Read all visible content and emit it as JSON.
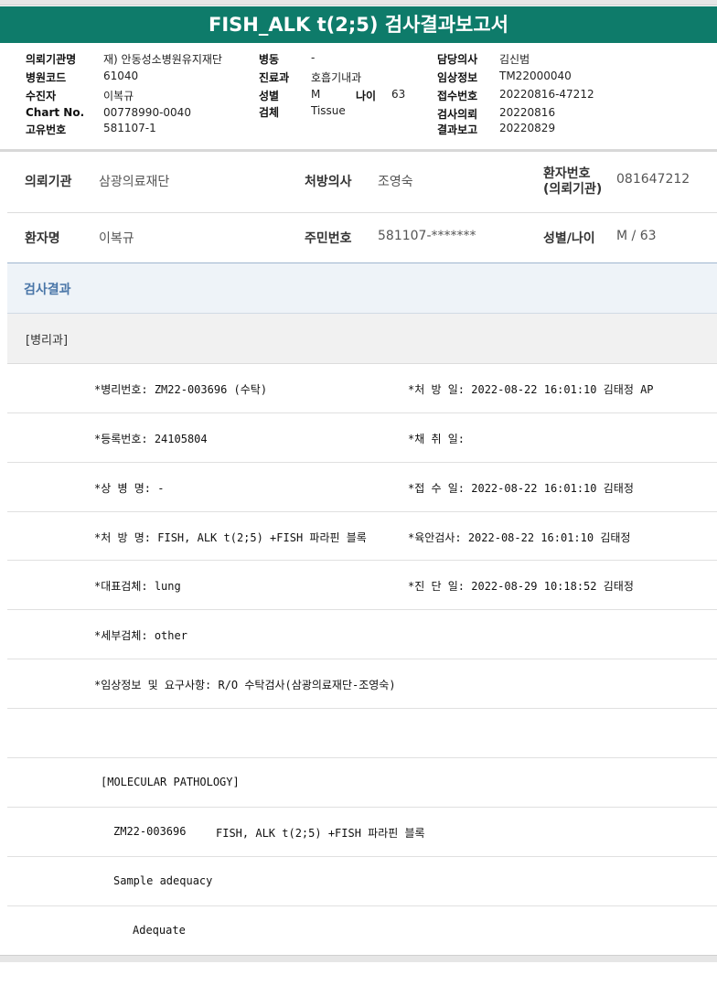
{
  "title": "FISH_ALK t(2;5) 검사결과보고서",
  "header": {
    "col1": [
      {
        "label": "의뢰기관명",
        "value": "재) 안동성소병원유지재단"
      },
      {
        "label": "병원코드",
        "value": "61040"
      },
      {
        "label": "수진자",
        "value": "이복규"
      },
      {
        "label": "Chart No.",
        "value": "00778990-0040"
      },
      {
        "label": "고유번호",
        "value": "581107-1"
      }
    ],
    "col2": [
      {
        "label": "병동",
        "value": "-"
      },
      {
        "label": "진료과",
        "value": "호흡기내과"
      },
      {
        "label": "성별",
        "value": "M"
      },
      {
        "label": "검체",
        "value": "Tissue"
      }
    ],
    "age": {
      "label": "나이",
      "value": "63"
    },
    "col3": [
      {
        "label": "담당의사",
        "value": "김신범"
      },
      {
        "label": "임상정보",
        "value": "TM22000040"
      },
      {
        "label": "접수번호",
        "value": "20220816-47212"
      },
      {
        "label": "검사의뢰",
        "value": "20220816"
      },
      {
        "label": "결과보고",
        "value": "20220829"
      }
    ]
  },
  "info": {
    "institution_label": "의뢰기관",
    "institution_value": "삼광의료재단",
    "doctor_label": "처방의사",
    "doctor_value": "조영숙",
    "patient_no_label_1": "환자번호",
    "patient_no_label_2": "(의뢰기관)",
    "patient_no_value": "081647212",
    "patient_name_label": "환자명",
    "patient_name_value": "이복규",
    "resident_no_label": "주민번호",
    "resident_no_value": "581107-*******",
    "sex_age_label": "성별/나이",
    "sex_age_value": "M / 63"
  },
  "result_section": "검사결과",
  "department": "[병리과]",
  "rows": [
    {
      "left": "*병리번호: ZM22-003696 (수탁)",
      "right": "*처 방 일: 2022-08-22 16:01:10  김태정 AP"
    },
    {
      "left": "*등록번호: 24105804",
      "right": "*채 취 일:"
    },
    {
      "left": "*상 병 명: -",
      "right": "*접 수 일: 2022-08-22 16:01:10  김태정"
    },
    {
      "left": "*처 방 명: FISH, ALK t(2;5) +FISH 파라핀 블록",
      "right": "*육안검사: 2022-08-22 16:01:10  김태정"
    },
    {
      "left": "*대표검체: lung",
      "right": "*진 단 일: 2022-08-29 10:18:52  김태정"
    },
    {
      "left": "*세부검체: other",
      "right": ""
    },
    {
      "left": "*임상정보 및 요구사항: R/O 수탁검사(삼광의료재단-조영숙)",
      "right": ""
    }
  ],
  "molecular": {
    "heading": "[MOLECULAR PATHOLOGY]",
    "line1_id": "ZM22-003696",
    "line1_test": "FISH, ALK t(2;5) +FISH 파라핀 블록",
    "line2": "Sample adequacy",
    "line3": "Adequate"
  }
}
